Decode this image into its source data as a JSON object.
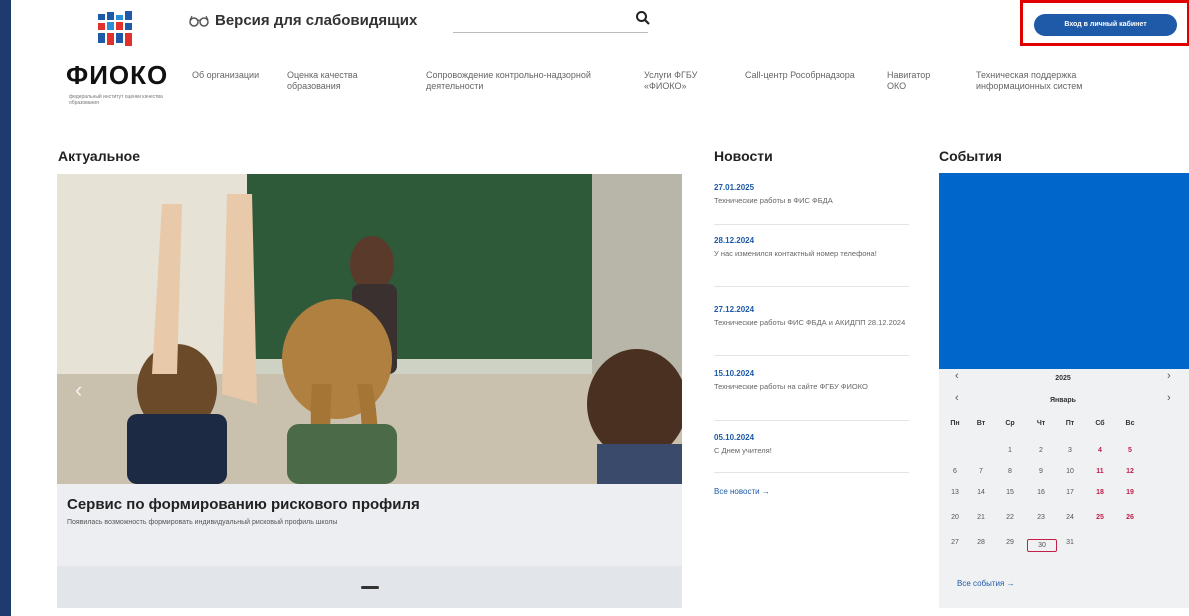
{
  "header": {
    "logo_text": "ФИОКО",
    "logo_subtitle": "федеральный институт оценки качества образования",
    "vision_label": "Версия для слабовидящих",
    "search_placeholder": "",
    "login_button": "Вход в личный кабинет",
    "nav": [
      "Об организации",
      "Оценка качества образования",
      "Сопровождение контрольно-надзорной деятельности",
      "Услуги ФГБУ «ФИОКО»",
      "Call-центр Рособрнадзора",
      "Навигатор ОКО",
      "Техническая поддержка информационных систем"
    ],
    "colors": {
      "accent": "#1e5aa8",
      "highlight": "#e00000"
    }
  },
  "actual": {
    "title": "Актуальное",
    "slide_title": "Сервис по формированию рискового профиля",
    "slide_subtitle": "Появилась возможность формировать индивидуальный рисковый профиль школы",
    "prev_icon": "chevron-left-icon"
  },
  "news": {
    "title": "Новости",
    "items": [
      {
        "date": "27.01.2025",
        "text": "Технические работы в ФИС ФБДА"
      },
      {
        "date": "28.12.2024",
        "text": "У нас изменился контактный номер телефона!"
      },
      {
        "date": "27.12.2024",
        "text": "Технические работы ФИС ФБДА и АКИДПП 28.12.2024"
      },
      {
        "date": "15.10.2024",
        "text": "Технические работы на сайте ФГБУ ФИОКО"
      },
      {
        "date": "05.10.2024",
        "text": "С Днем учителя!"
      }
    ],
    "all_link": "Все новости →"
  },
  "events": {
    "title": "События",
    "year": "2025",
    "month": "Январь",
    "weekdays": [
      "Пн",
      "Вт",
      "Ср",
      "Чт",
      "Пт",
      "Сб",
      "Вс"
    ],
    "weeks": [
      [
        "",
        "",
        "1",
        "2",
        "3",
        "4",
        "5"
      ],
      [
        "6",
        "7",
        "8",
        "9",
        "10",
        "11",
        "12"
      ],
      [
        "13",
        "14",
        "15",
        "16",
        "17",
        "18",
        "19"
      ],
      [
        "20",
        "21",
        "22",
        "23",
        "24",
        "25",
        "26"
      ],
      [
        "27",
        "28",
        "29",
        "30",
        "31",
        "",
        ""
      ]
    ],
    "today": "30",
    "all_link": "Все события →"
  }
}
